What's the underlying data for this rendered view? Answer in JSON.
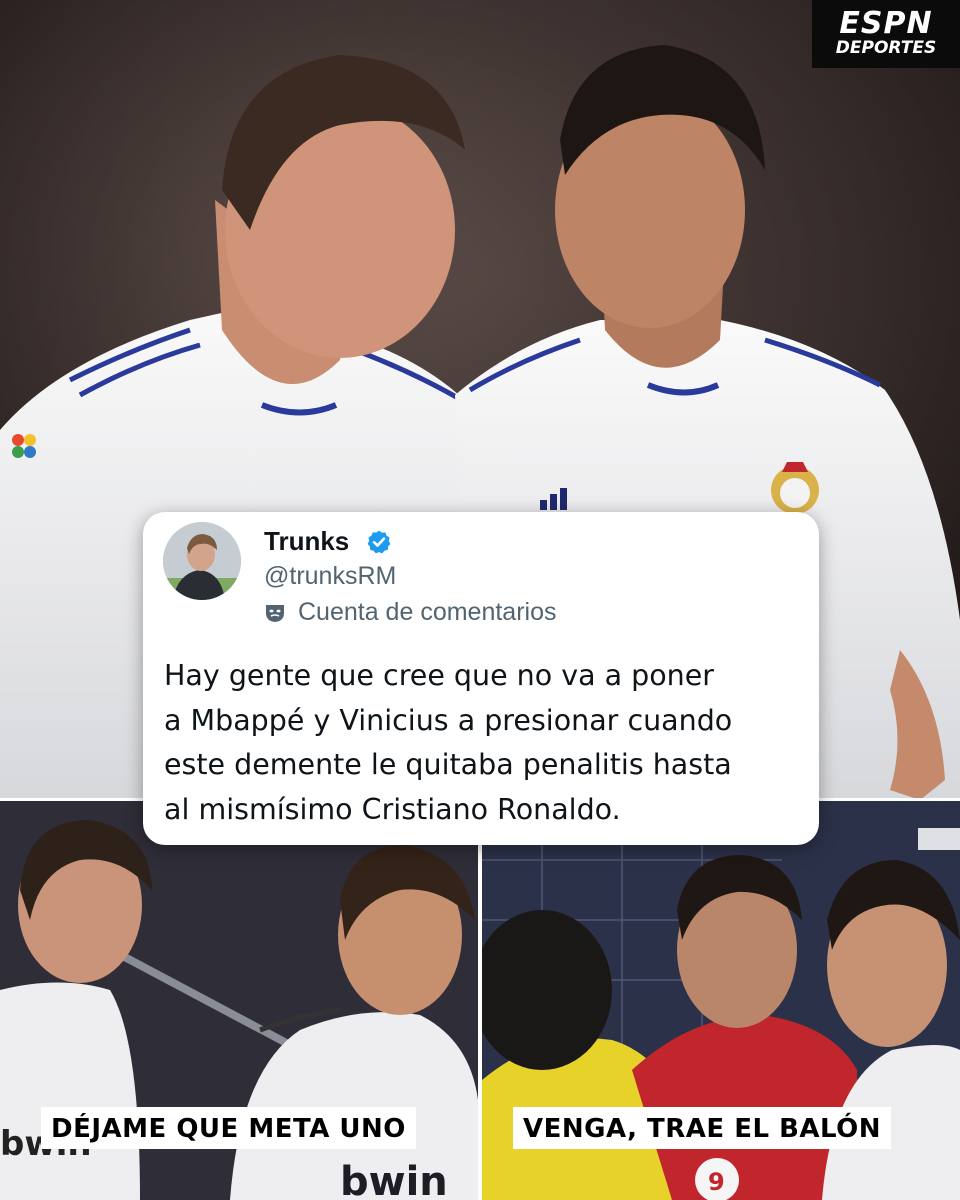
{
  "logo": {
    "line1": "ESPN",
    "line2": "DEPORTES"
  },
  "tweet": {
    "name": "Trunks",
    "handle": "@trunksRM",
    "account_label": "Cuenta de comentarios",
    "text": "Hay gente que cree que no va a poner\na Mbappé y Vinicius a presionar  cuando\neste demente le quitaba penalitis hasta\nal mismísimo Cristiano Ronaldo.",
    "verified_color": "#1d9bf0"
  },
  "jersey": {
    "brand": "adidas",
    "sponsor": "bwin"
  },
  "captions": {
    "left": "DÉJAME QUE META UNO",
    "right": "VENGA, TRAE EL BALÓN"
  },
  "colors": {
    "kit_white": "#f2f2f4",
    "kit_trim": "#2a3a9a",
    "opponent_red": "#c0262c",
    "opponent_yellow": "#e7d22a"
  }
}
